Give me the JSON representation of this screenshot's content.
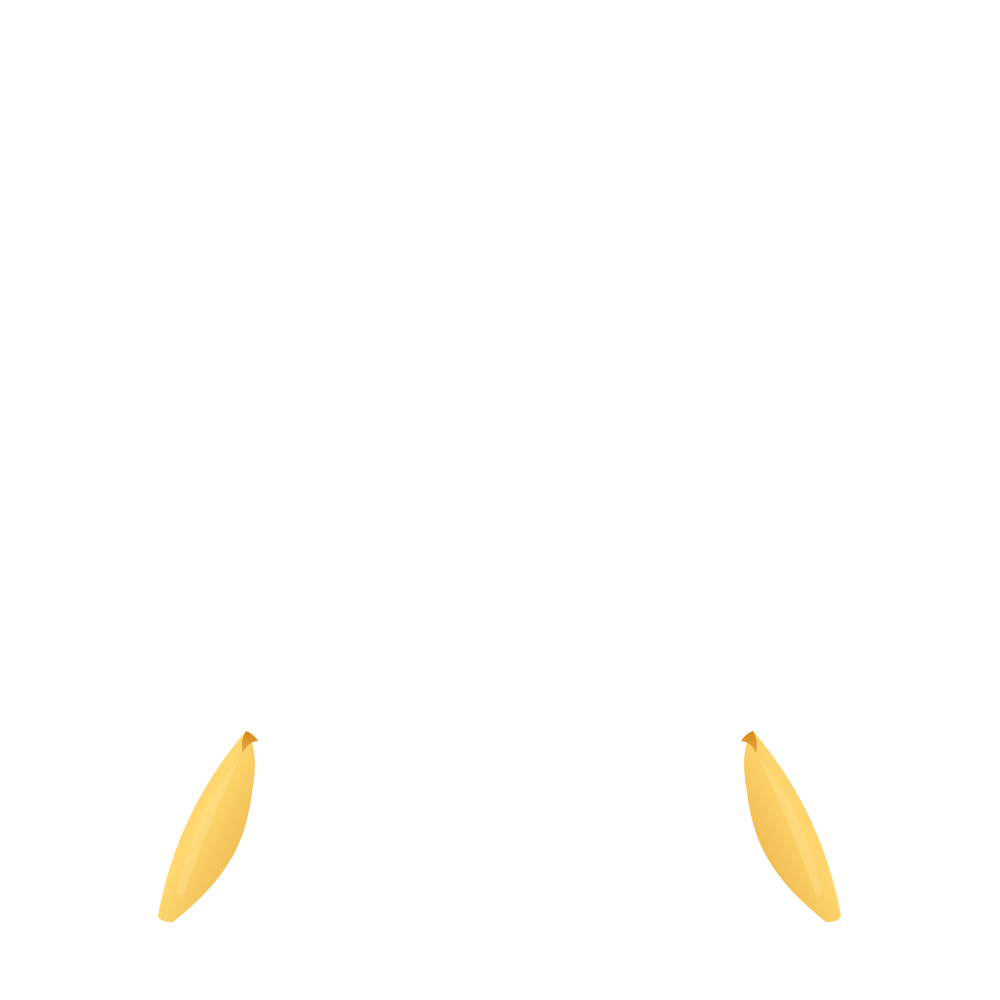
{
  "scene": {
    "subject": "gold-leaf-stud-earrings-pair",
    "background_color": "#ffffff",
    "colors": {
      "gold_light": "#ffd66e",
      "gold_mid": "#f1b94f",
      "gold_dark": "#d68a14",
      "gold_edge": "#c98215"
    }
  }
}
